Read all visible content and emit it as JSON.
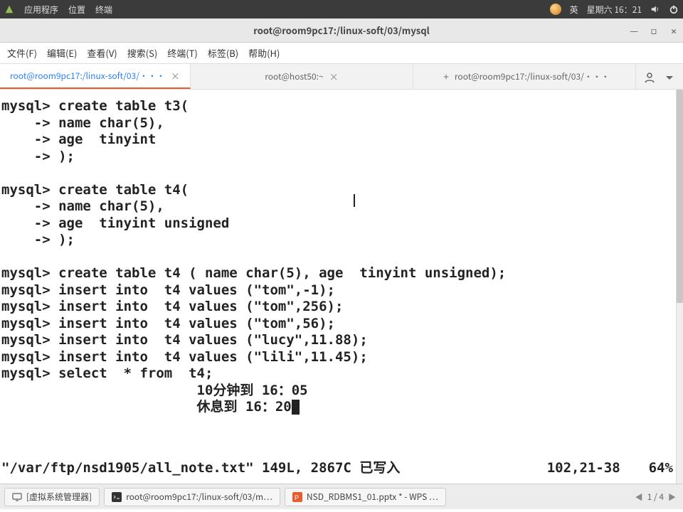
{
  "system_bar": {
    "apps": "应用程序",
    "places": "位置",
    "terminal": "终端",
    "ime": "英",
    "datetime": "星期六 16：21"
  },
  "window": {
    "title": "root@room9pc17:/linux-soft/03/mysql"
  },
  "menu": {
    "file": "文件(F)",
    "edit": "编辑(E)",
    "view": "查看(V)",
    "search": "搜索(S)",
    "terminal": "终端(T)",
    "tabs": "标签(B)",
    "help": "帮助(H)"
  },
  "tabs": [
    {
      "label": "root@room9pc17:/linux-soft/03/···",
      "active": true,
      "closable": true
    },
    {
      "label": "root@host50:~",
      "active": false,
      "closable": true
    },
    {
      "label": "root@room9pc17:/linux-soft/03/···",
      "active": false,
      "closable": false
    }
  ],
  "terminal_lines": [
    "mysql> create table t3(",
    "    -> name char(5),",
    "    -> age  tinyint",
    "    -> );",
    "",
    "mysql> create table t4(",
    "    -> name char(5),",
    "    -> age  tinyint unsigned",
    "    -> );",
    "",
    "mysql> create table t4 ( name char(5), age  tinyint unsigned);",
    "mysql> insert into  t4 values (\"tom\",-1);",
    "mysql> insert into  t4 values (\"tom\",256);",
    "mysql> insert into  t4 values (\"tom\",56);",
    "mysql> insert into  t4 values (\"lucy\",11.88);",
    "mysql> insert into  t4 values (\"lili\",11.45);",
    "mysql> select  * from  t4;",
    "                        10分钟到 16：05",
    "                        休息到 16：20"
  ],
  "status": {
    "msg": "\"/var/ftp/nsd1905/all_note.txt\" 149L, 2867C 已写入",
    "pos": "102,21-38",
    "pct": "64%"
  },
  "taskbar": {
    "items": [
      {
        "label": "[虚拟系统管理器]",
        "kind": "vm"
      },
      {
        "label": "root@room9pc17:/linux-soft/03/m…",
        "kind": "term"
      },
      {
        "label": "NSD_RDBMS1_01.pptx * - WPS …",
        "kind": "wps"
      }
    ],
    "pager": "1 / 4"
  }
}
